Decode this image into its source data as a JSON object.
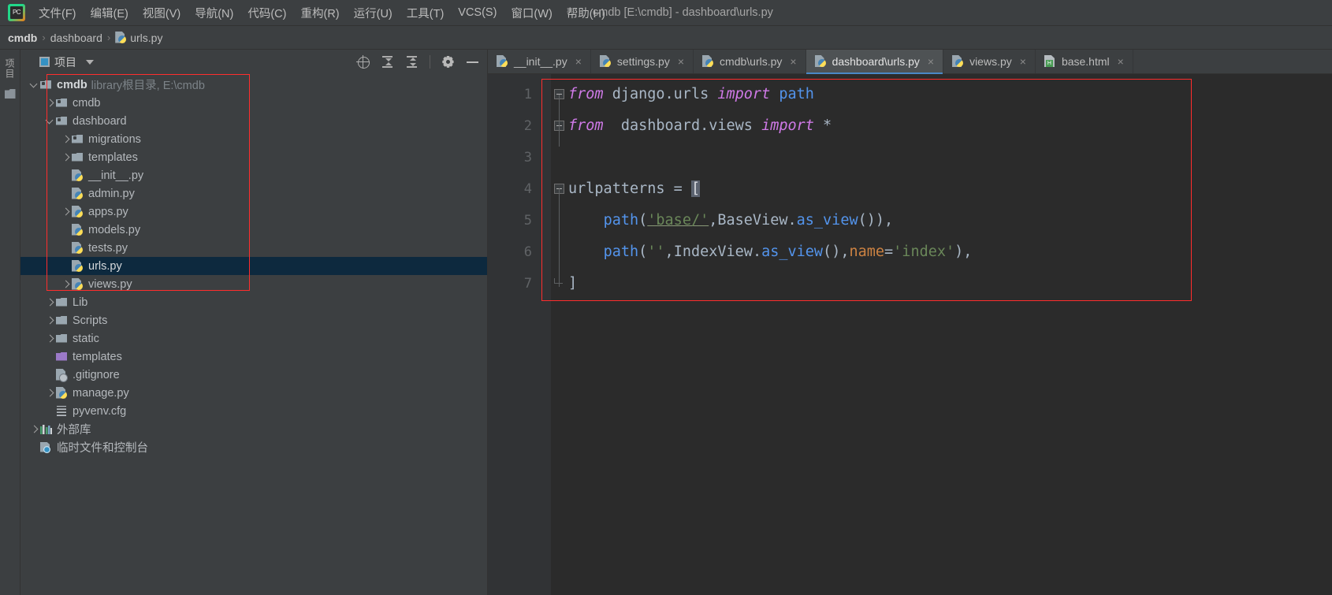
{
  "window": {
    "title": "cmdb [E:\\cmdb] - dashboard\\urls.py",
    "logo_text": "PC"
  },
  "menubar": {
    "items": [
      {
        "label": "文件(F)",
        "name": "menu-file"
      },
      {
        "label": "编辑(E)",
        "name": "menu-edit"
      },
      {
        "label": "视图(V)",
        "name": "menu-view"
      },
      {
        "label": "导航(N)",
        "name": "menu-navigate"
      },
      {
        "label": "代码(C)",
        "name": "menu-code"
      },
      {
        "label": "重构(R)",
        "name": "menu-refactor"
      },
      {
        "label": "运行(U)",
        "name": "menu-run"
      },
      {
        "label": "工具(T)",
        "name": "menu-tools"
      },
      {
        "label": "VCS(S)",
        "name": "menu-vcs"
      },
      {
        "label": "窗口(W)",
        "name": "menu-window"
      },
      {
        "label": "帮助(H)",
        "name": "menu-help"
      }
    ]
  },
  "breadcrumb": {
    "sep": "›",
    "items": [
      {
        "label": "cmdb",
        "bold": true
      },
      {
        "label": "dashboard",
        "bold": false
      },
      {
        "label": "urls.py",
        "bold": false,
        "icon": "py-file-icon"
      }
    ]
  },
  "toolstrip": {
    "project_tab_label": "项目",
    "structure_icon": "folder-icon"
  },
  "project_pane": {
    "title": "项目",
    "dropdown_icon": "chevron-down-icon",
    "tools": [
      {
        "name": "select-opened-file-icon",
        "label": "locate"
      },
      {
        "name": "expand-all-icon",
        "label": "expand all"
      },
      {
        "name": "collapse-all-icon",
        "label": "collapse all"
      },
      {
        "name": "settings-gear-icon",
        "label": "settings"
      },
      {
        "name": "hide-panel-icon",
        "label": "hide"
      }
    ],
    "tree": [
      {
        "label": "cmdb",
        "suffix": "library根目录, E:\\cmdb",
        "depth": 0,
        "arrow": "down",
        "icon": "module-folder-icon",
        "bold": true,
        "selected": false
      },
      {
        "label": "cmdb",
        "suffix": "",
        "depth": 1,
        "arrow": "right",
        "icon": "module-folder-icon",
        "bold": false,
        "selected": false
      },
      {
        "label": "dashboard",
        "suffix": "",
        "depth": 1,
        "arrow": "down",
        "icon": "module-folder-icon",
        "bold": false,
        "selected": false
      },
      {
        "label": "migrations",
        "suffix": "",
        "depth": 2,
        "arrow": "right",
        "icon": "module-folder-icon",
        "bold": false,
        "selected": false
      },
      {
        "label": "templates",
        "suffix": "",
        "depth": 2,
        "arrow": "right",
        "icon": "folder-icon",
        "bold": false,
        "selected": false
      },
      {
        "label": "__init__.py",
        "suffix": "",
        "depth": 2,
        "arrow": "none",
        "icon": "python-file-icon",
        "bold": false,
        "selected": false
      },
      {
        "label": "admin.py",
        "suffix": "",
        "depth": 2,
        "arrow": "none",
        "icon": "python-file-icon",
        "bold": false,
        "selected": false
      },
      {
        "label": "apps.py",
        "suffix": "",
        "depth": 2,
        "arrow": "right",
        "icon": "python-file-icon",
        "bold": false,
        "selected": false
      },
      {
        "label": "models.py",
        "suffix": "",
        "depth": 2,
        "arrow": "none",
        "icon": "python-file-icon",
        "bold": false,
        "selected": false
      },
      {
        "label": "tests.py",
        "suffix": "",
        "depth": 2,
        "arrow": "none",
        "icon": "python-file-icon",
        "bold": false,
        "selected": false
      },
      {
        "label": "urls.py",
        "suffix": "",
        "depth": 2,
        "arrow": "none",
        "icon": "python-file-icon",
        "bold": false,
        "selected": true
      },
      {
        "label": "views.py",
        "suffix": "",
        "depth": 2,
        "arrow": "right",
        "icon": "python-file-icon",
        "bold": false,
        "selected": false
      },
      {
        "label": "Lib",
        "suffix": "",
        "depth": 1,
        "arrow": "right",
        "icon": "folder-icon",
        "bold": false,
        "selected": false
      },
      {
        "label": "Scripts",
        "suffix": "",
        "depth": 1,
        "arrow": "right",
        "icon": "folder-icon",
        "bold": false,
        "selected": false
      },
      {
        "label": "static",
        "suffix": "",
        "depth": 1,
        "arrow": "right",
        "icon": "folder-icon",
        "bold": false,
        "selected": false
      },
      {
        "label": "templates",
        "suffix": "",
        "depth": 1,
        "arrow": "none",
        "icon": "folder-purple-icon",
        "bold": false,
        "selected": false
      },
      {
        "label": ".gitignore",
        "suffix": "",
        "depth": 1,
        "arrow": "none",
        "icon": "gitignore-file-icon",
        "bold": false,
        "selected": false
      },
      {
        "label": "manage.py",
        "suffix": "",
        "depth": 1,
        "arrow": "right",
        "icon": "python-file-icon",
        "bold": false,
        "selected": false
      },
      {
        "label": "pyvenv.cfg",
        "suffix": "",
        "depth": 1,
        "arrow": "none",
        "icon": "config-file-icon",
        "bold": false,
        "selected": false
      },
      {
        "label": "外部库",
        "suffix": "",
        "depth": 0,
        "arrow": "right",
        "icon": "external-libraries-icon",
        "bold": false,
        "selected": false
      },
      {
        "label": "临时文件和控制台",
        "suffix": "",
        "depth": 0,
        "arrow": "none",
        "icon": "scratches-consoles-icon",
        "bold": false,
        "selected": false
      }
    ]
  },
  "editor": {
    "tabs": [
      {
        "label": "__init__.py",
        "icon": "python-file-icon",
        "active": false,
        "close": "×"
      },
      {
        "label": "settings.py",
        "icon": "python-file-icon",
        "active": false,
        "close": "×"
      },
      {
        "label": "cmdb\\urls.py",
        "icon": "python-file-icon",
        "active": false,
        "close": "×"
      },
      {
        "label": "dashboard\\urls.py",
        "icon": "python-file-icon",
        "active": true,
        "close": "×"
      },
      {
        "label": "views.py",
        "icon": "python-file-icon",
        "active": false,
        "close": "×"
      },
      {
        "label": "base.html",
        "icon": "html-file-icon",
        "active": false,
        "close": "×"
      }
    ],
    "line_numbers": [
      "1",
      "2",
      "3",
      "4",
      "5",
      "6",
      "7"
    ],
    "code_lines": [
      {
        "n": "1",
        "text": "from django.urls import path"
      },
      {
        "n": "2",
        "text": "from  dashboard.views import *"
      },
      {
        "n": "3",
        "text": ""
      },
      {
        "n": "4",
        "text": "urlpatterns = ["
      },
      {
        "n": "5",
        "text": "    path('base/',BaseView.as_view()),"
      },
      {
        "n": "6",
        "text": "    path('',IndexView.as_view(),name='index'),"
      },
      {
        "n": "7",
        "text": "]"
      }
    ]
  },
  "colors": {
    "keyword": "#d07ae8",
    "string": "#6a8759",
    "method": "#5394ec",
    "named_arg": "#cc8242",
    "plain": "#a9b7c6",
    "accent": "#4a88c7",
    "selection": "#0d293e",
    "annotation": "#ff2d2d"
  }
}
